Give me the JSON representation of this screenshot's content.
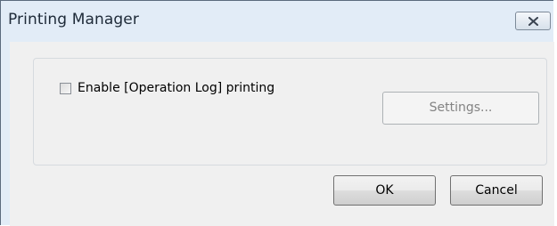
{
  "window": {
    "title": "Printing Manager",
    "close_icon": "close-icon"
  },
  "options": {
    "enable_operation_log_label": "Enable [Operation Log] printing",
    "enable_operation_log_checked": false,
    "settings_label": "Settings...",
    "settings_enabled": false
  },
  "footer": {
    "ok_label": "OK",
    "cancel_label": "Cancel"
  },
  "colors": {
    "titlebar_bg": "#e2ecf7",
    "dialog_bg": "#f0f0f0"
  }
}
